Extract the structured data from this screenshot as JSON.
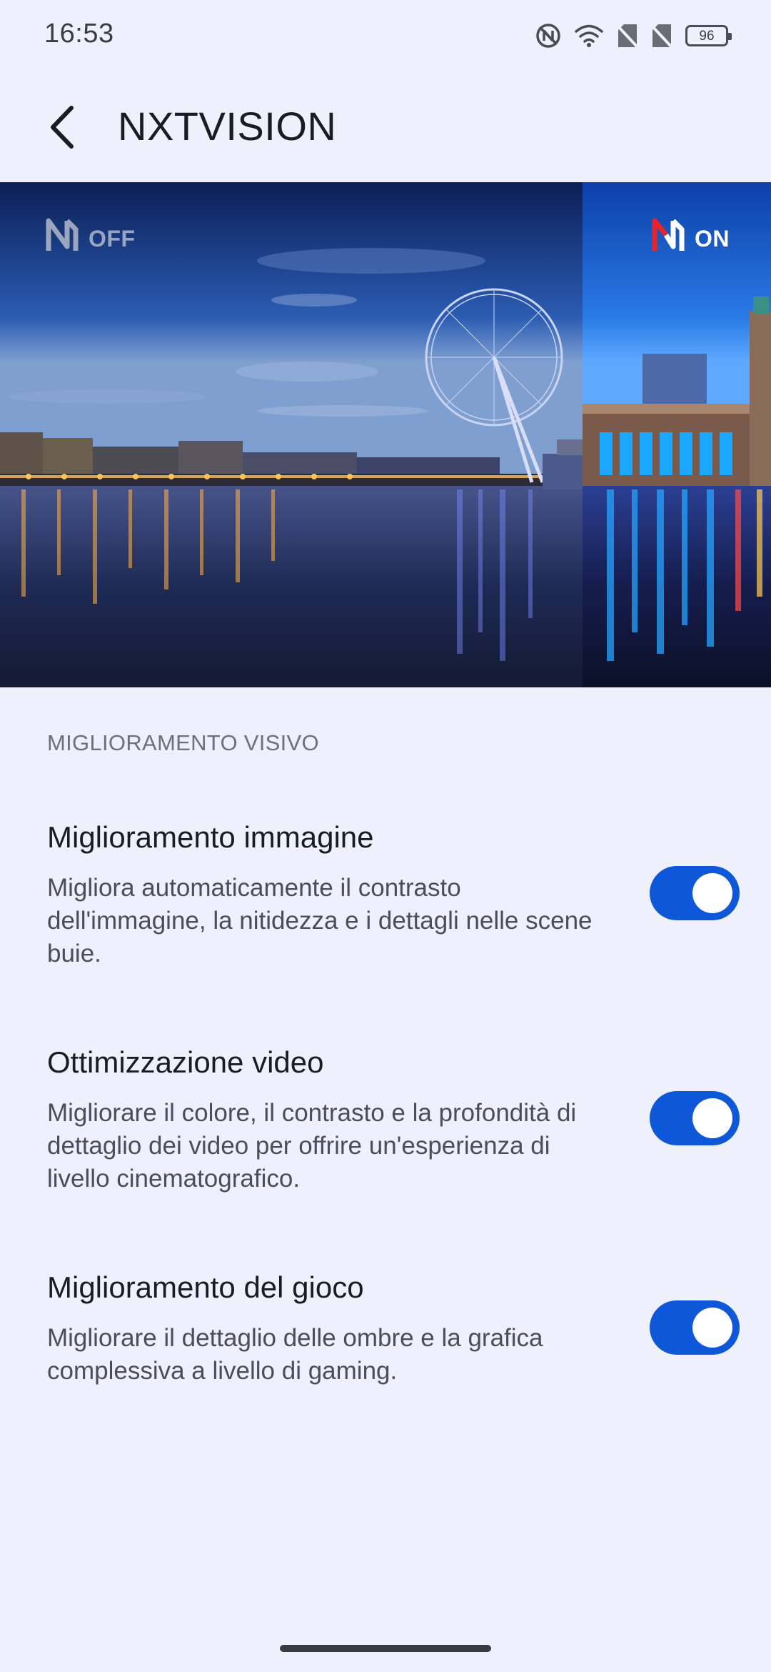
{
  "status_bar": {
    "time": "16:53",
    "battery_level": "96",
    "icons": [
      "nfc-icon",
      "wifi-icon",
      "no-sim-icon",
      "no-sim-icon",
      "battery-icon"
    ]
  },
  "app_bar": {
    "title": "NXTVISION",
    "back_icon": "back-arrow-icon"
  },
  "hero": {
    "off_label": "OFF",
    "on_label": "ON",
    "logo_icon": "nxtvision-logo-icon",
    "accent_on": "#e8232a",
    "accent_off": "#9aa6bd"
  },
  "section": {
    "header": "MIGLIORAMENTO VISIVO"
  },
  "settings": [
    {
      "title": "Miglioramento immagine",
      "description": "Migliora automaticamente il contrasto dell'immagine, la nitidezza e i dettagli nelle scene buie.",
      "enabled": true
    },
    {
      "title": "Ottimizzazione video",
      "description": "Migliorare il colore, il contrasto e la profondità di dettaglio dei video per offrire un'esperienza di livello cinematografico.",
      "enabled": true
    },
    {
      "title": "Miglioramento del gioco",
      "description": "Migliorare il dettaglio delle ombre e la grafica complessiva a livello di gaming.",
      "enabled": true
    }
  ],
  "colors": {
    "background": "#eef1fb",
    "toggle_on": "#0f57d9",
    "text_primary": "#1b1c22",
    "text_secondary": "#4b4d58"
  }
}
